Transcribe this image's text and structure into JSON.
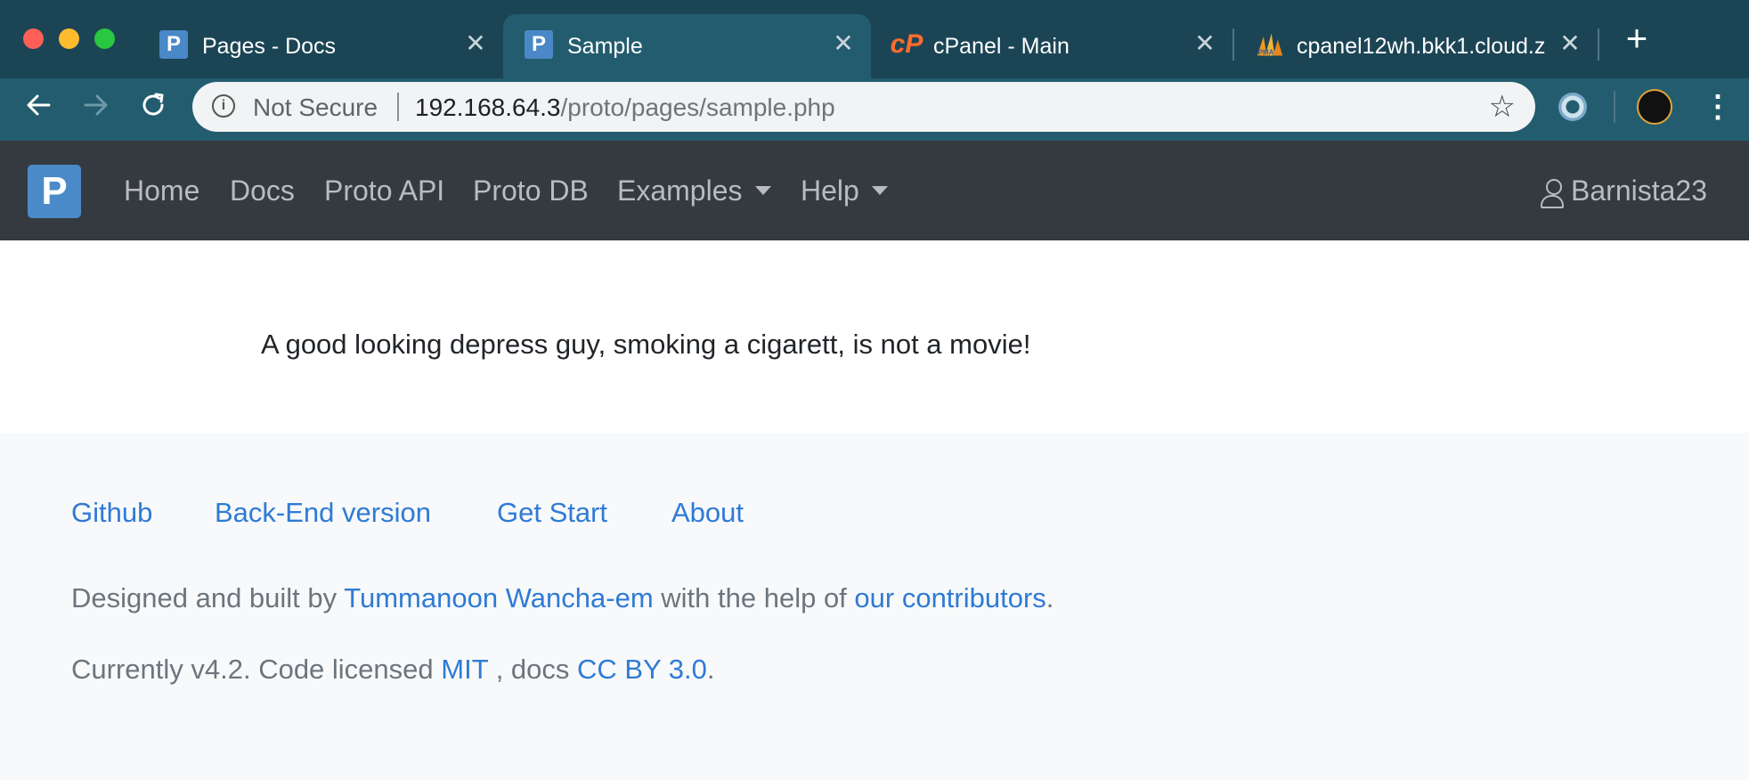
{
  "browser": {
    "tabs": [
      {
        "favicon": "proto-p-icon",
        "title": "Pages - Docs",
        "active": false
      },
      {
        "favicon": "proto-p-icon",
        "title": "Sample",
        "active": true
      },
      {
        "favicon": "cpanel-icon",
        "title": "cPanel - Main",
        "active": false
      },
      {
        "favicon": "phpmyadmin-icon",
        "title": "cpanel12wh.bkk1.cloud.z",
        "active": false
      }
    ],
    "new_tab_icon": "plus-icon",
    "security_label": "Not Secure",
    "url_host": "192.168.64.3",
    "url_path": "/proto/pages/sample.php"
  },
  "navbar": {
    "brand": "P",
    "links": [
      "Home",
      "Docs",
      "Proto API",
      "Proto DB",
      "Examples",
      "Help"
    ],
    "user": "Barnista23",
    "brand_color": "#4b8ac8"
  },
  "main": {
    "text": "A good looking depress guy, smoking a cigarett, is not a movie!"
  },
  "footer": {
    "links": [
      "Github",
      "Back-End version",
      "Get Start",
      "About"
    ],
    "credit": {
      "prefix": "Designed and built by ",
      "author": "Tummanoon Wancha-em",
      "middle": " with the help of ",
      "contributors": "our contributors",
      "suffix": "."
    },
    "license": {
      "prefix": "Currently v4.2. Code licensed ",
      "code_license": "MIT",
      "middle": " , docs ",
      "docs_license": "CC BY 3.0",
      "suffix": "."
    },
    "link_color": "#2e7bd6"
  }
}
